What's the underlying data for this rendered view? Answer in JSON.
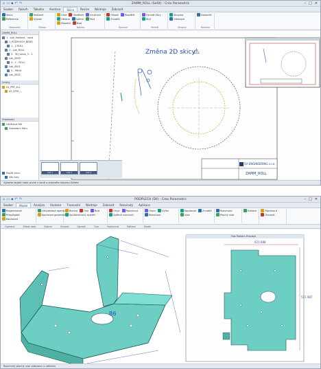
{
  "window1": {
    "title": "ZAMM_ROLL (Sešit) - Creo Parametric",
    "tabs": [
      "Soubor",
      "Rozvrh",
      "Tabulka",
      "Anotace",
      "Skica",
      "Revize",
      "Nástroje",
      "Zobrazit"
    ],
    "active_tab": 4,
    "ribbon_groups": [
      {
        "label": "Nastavení",
        "items": [
          "Skica",
          "Reference"
        ]
      },
      {
        "label": "Odkazy",
        "items": [
          "Sestavit",
          "Vybrat"
        ]
      },
      {
        "label": "Nákres",
        "items": [
          "Čára",
          "Obdélník",
          "Kružnice",
          "Oblouk",
          "Spline",
          "Text",
          "Zkosení",
          "Bod"
        ]
      },
      {
        "label": "Operace",
        "items": [
          "Ořezat",
          "Rozdělit",
          "Zrcadlit"
        ]
      },
      {
        "label": "Formát",
        "items": [
          "Formát čáry",
          "Styl"
        ]
      },
      {
        "label": "Skupiny",
        "items": [
          "Skupina",
          "Odskupit"
        ]
      },
      {
        "label": "Kontrola",
        "items": [
          "Dokončit"
        ]
      }
    ],
    "callout": "Změna 2D skicy",
    "warning_icon": "warning-icon",
    "tree_header": "ZAMM_ROLL",
    "tree_items": [
      "1 - Lak_čásťové - nová",
      "1_PODPLECH_NEW1",
      "1 - 2 ROLL",
      "2 - Lak_ROLL",
      "3 - 3D_vlevo_3 - 1",
      "Lak_0000",
      "4 - 1 - ROLL",
      "Lak_0001",
      "5 - PRUH",
      "Lak_0002"
    ],
    "layers_header": "Vrstvy",
    "layer_items": [
      "01_PRT_ALL",
      "02_DTM_..."
    ],
    "props_header": "Vlastnosti",
    "props_items": [
      "Výběrová filtr",
      "Zobrazení filtru"
    ],
    "props_bottom": [
      "Použít skicu",
      "Vše listy"
    ],
    "sheet_tabs": [
      "List 1",
      "List 2",
      "List 3"
    ],
    "titleblock_company": "SV ENGINEERING s.r.o.",
    "titleblock_part": "ZAMM_ROLL",
    "status": "Vyberte objekt nebo prvek v okně a stiskněte klávesu Delete"
  },
  "window2": {
    "title": "PODPLECH (Díl) - Creo Parametric",
    "tabs": [
      "Soubor",
      "Model",
      "Analýza",
      "Anotace",
      "Tvarování",
      "Nástroje",
      "Zobrazit",
      "Rozvinutý",
      "Aplikace"
    ],
    "active_tab": 1,
    "ribbon_groups": [
      {
        "label": "Operace",
        "items": [
          "Regenerovat",
          "Přizpůsobit",
          "Kopírovat"
        ]
      },
      {
        "label": "Získat data",
        "items": [
          "Uživatelská operace",
          "Kopírovat geometrii"
        ]
      },
      {
        "label": "Datum",
        "items": [
          "Rovina",
          "Osa",
          "Bod",
          "Souřadnicový systém"
        ]
      },
      {
        "label": "Ohnout",
        "items": [
          "Ohyb",
          "Rozvinout",
          "Zpětné rozvinutí"
        ]
      },
      {
        "label": "Upravit",
        "items": [
          "Otvor",
          "Výřez",
          "Rozvinout"
        ]
      },
      {
        "label": "Tvar",
        "items": [
          "Kopírovat",
          "Zrcadlit",
          "Vzor"
        ]
      },
      {
        "label": "Rozvinout",
        "items": [
          "Rozvinout",
          "Plochý vzor"
        ]
      },
      {
        "label": "Editace",
        "items": [
          "Editace"
        ]
      },
      {
        "label": "Model",
        "items": [
          "Rozvinout",
          "Obnovit"
        ]
      }
    ],
    "preview_title": "Flat Pattern Preview",
    "dim_width": "621.988",
    "dim_height": "521.987",
    "dim_b6": "B6",
    "status": "Rozvinutý plochý vzor zobrazen v náhledu"
  }
}
